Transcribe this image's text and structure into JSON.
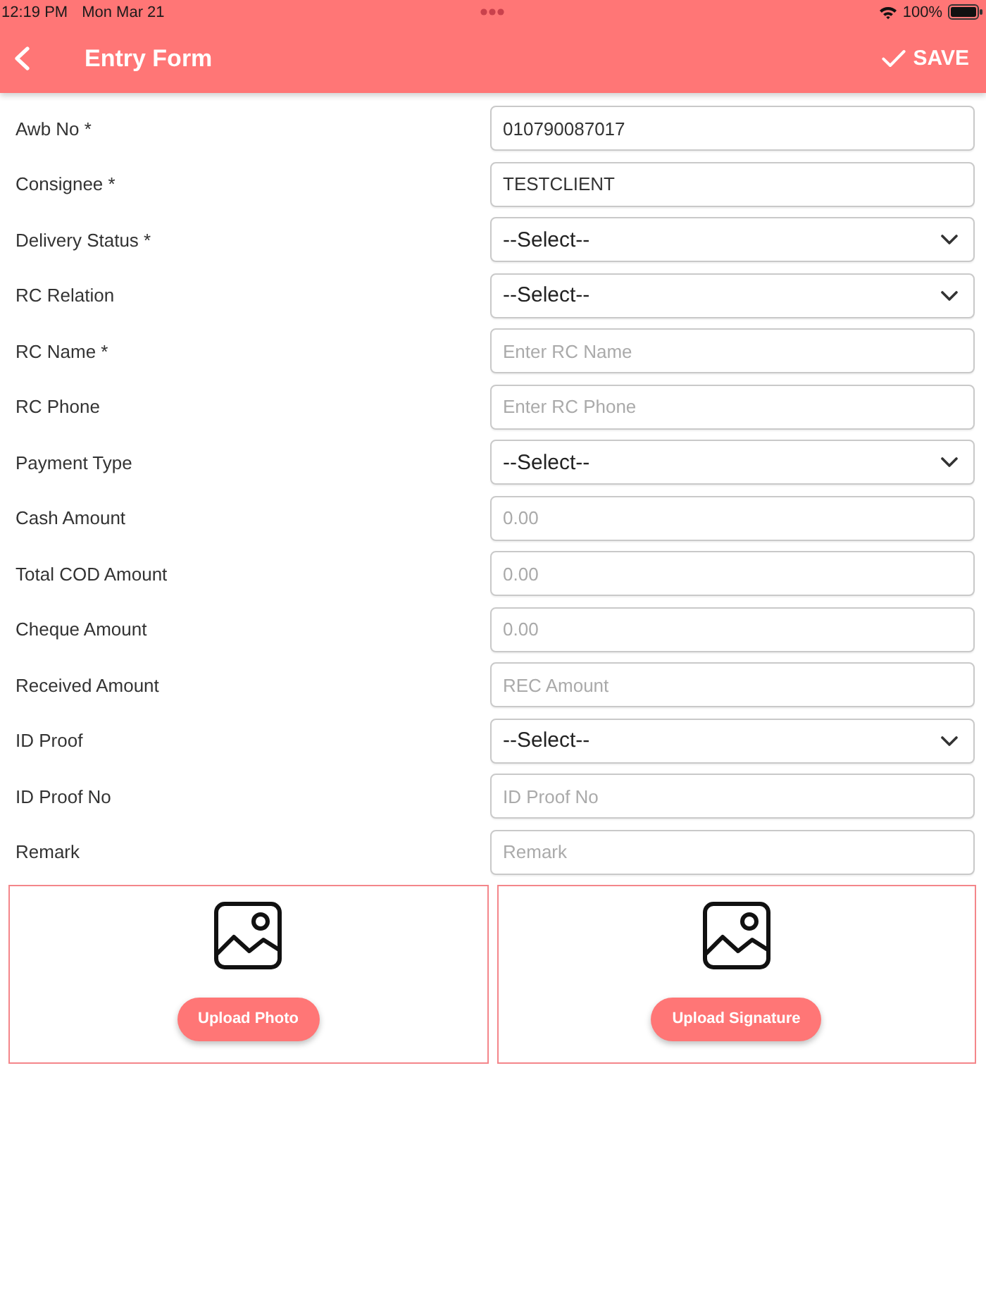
{
  "status_bar": {
    "time": "12:19 PM",
    "date": "Mon Mar 21",
    "battery": "100%"
  },
  "header": {
    "title": "Entry Form",
    "save_label": "SAVE"
  },
  "form": {
    "rows": [
      {
        "label": "Awb No *",
        "kind": "input",
        "value": "010790087017"
      },
      {
        "label": "Consignee *",
        "kind": "input",
        "value": "TESTCLIENT"
      },
      {
        "label": "Delivery Status *",
        "kind": "select",
        "value": "--Select--"
      },
      {
        "label": "RC Relation",
        "kind": "select",
        "value": "--Select--"
      },
      {
        "label": "RC Name *",
        "kind": "input",
        "placeholder": "Enter RC Name"
      },
      {
        "label": "RC Phone",
        "kind": "input",
        "placeholder": "Enter RC Phone"
      },
      {
        "label": "Payment Type",
        "kind": "select",
        "value": "--Select--"
      },
      {
        "label": "Cash Amount",
        "kind": "input",
        "placeholder": "0.00"
      },
      {
        "label": "Total COD Amount",
        "kind": "input",
        "placeholder": "0.00"
      },
      {
        "label": "Cheque Amount",
        "kind": "input",
        "placeholder": "0.00"
      },
      {
        "label": "Received Amount",
        "kind": "input",
        "placeholder": "REC Amount"
      },
      {
        "label": "ID Proof",
        "kind": "select",
        "value": "--Select--"
      },
      {
        "label": "ID Proof No",
        "kind": "input",
        "placeholder": "ID Proof No"
      },
      {
        "label": "Remark",
        "kind": "input",
        "placeholder": "Remark"
      }
    ]
  },
  "uploads": [
    {
      "button": "Upload Photo"
    },
    {
      "button": "Upload Signature"
    }
  ]
}
